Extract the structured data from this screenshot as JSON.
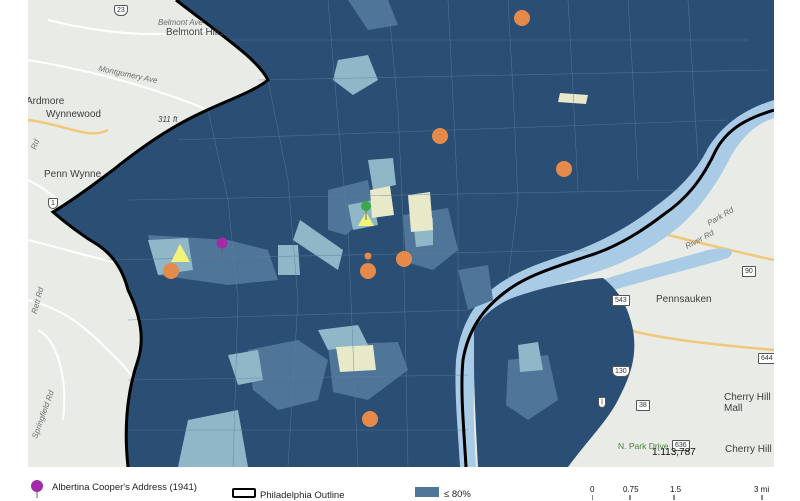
{
  "map": {
    "colors": {
      "dark": "#2a4e74",
      "mid": "#4f7599",
      "light": "#8fb7c8",
      "pale": "#e8e9c9",
      "water": "#a9cbe6",
      "land": "#e8ebe6",
      "outline": "#000000",
      "marker_orange": "#e58a4a",
      "marker_yellow": "#f2f47a",
      "marker_purple": "#a32ba8",
      "marker_green": "#3aa84a"
    },
    "place_labels": [
      "Belmont Hills",
      "Ardmore",
      "Wynnewood",
      "Penn Wynne",
      "Pennsauken",
      "Cherry Hill Mall",
      "Cherry Hill"
    ],
    "road_labels": [
      "Montgomery Ave",
      "Belmont Ave",
      "Rd",
      "River Rd",
      "Park Rd",
      "Rett Rd",
      "Springfield Rd"
    ],
    "spot_elevation": "311 ft",
    "park_label": "N. Park Drive",
    "route_shields": [
      "23",
      "1",
      "90",
      "543",
      "130",
      "644",
      "38",
      "636"
    ]
  },
  "legend": {
    "address_label": "Albertina Cooper's Address (1941)",
    "outline_label": "Philadelphia Outline",
    "class_label": "≤ 80%"
  },
  "scale": {
    "ratio": "1:113,787",
    "ticks": [
      "0",
      "0.75",
      "1.5",
      "3 mi"
    ]
  }
}
